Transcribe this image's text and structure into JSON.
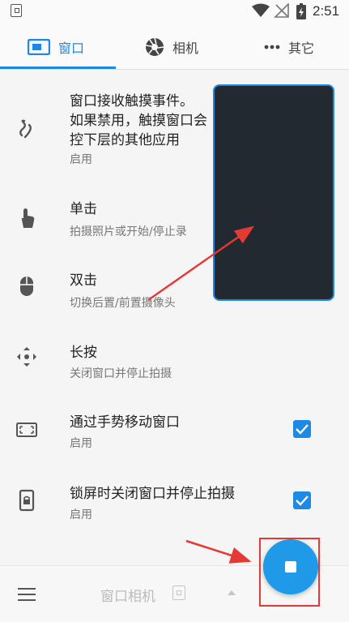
{
  "status_bar": {
    "time": "2:51",
    "icons": [
      "app-icon",
      "wifi-icon",
      "no-signal-icon",
      "battery-charging-icon"
    ]
  },
  "tabs": [
    {
      "label": "窗口",
      "icon": "window-icon",
      "active": true
    },
    {
      "label": "相机",
      "icon": "camera-shutter-icon",
      "active": false
    },
    {
      "label": "其它",
      "icon": "more-dots-icon",
      "active": false
    }
  ],
  "settings": [
    {
      "title": "窗口接收触摸事件。\n如果禁用，触摸窗口会\n控下层的其他应用",
      "subtitle": "启用",
      "icon": "touch-gesture-icon",
      "checked": null
    },
    {
      "title": "单击",
      "subtitle": "拍摄照片或开始/停止录",
      "icon": "tap-hand-icon",
      "checked": null
    },
    {
      "title": "双击",
      "subtitle": "切换后置/前置摄像头",
      "icon": "mouse-icon",
      "checked": null
    },
    {
      "title": "长按",
      "subtitle": "关闭窗口并停止拍摄",
      "icon": "move-arrows-icon",
      "checked": null
    },
    {
      "title": "通过手势移动窗口",
      "subtitle": "启用",
      "icon": "window-frame-icon",
      "checked": true
    },
    {
      "title": "锁屏时关闭窗口并停止拍摄",
      "subtitle": "启用",
      "icon": "lock-screen-icon",
      "checked": true
    }
  ],
  "bottom_bar": {
    "title": "窗口相机",
    "menu_icon": "menu-icon",
    "fab_icon": "stop-icon"
  },
  "colors": {
    "accent": "#1e88e5",
    "annotation": "#e53935",
    "preview_bg": "#232931"
  }
}
